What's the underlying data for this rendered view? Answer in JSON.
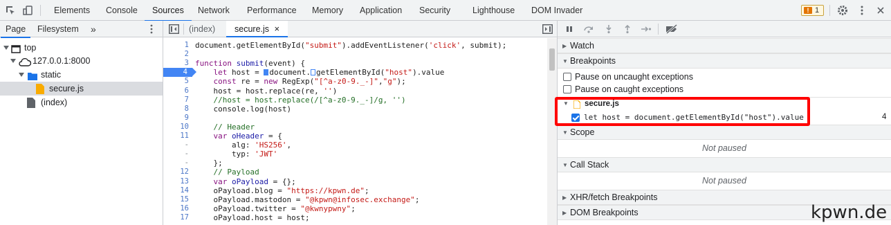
{
  "top_tabs": [
    "Elements",
    "Console",
    "Sources",
    "Network",
    "Performance",
    "Memory",
    "Application",
    "Security",
    "Lighthouse",
    "DOM Invader"
  ],
  "issues_count": "1",
  "navigator": {
    "tabs": [
      "Page",
      "Filesystem"
    ],
    "more": "»",
    "tree": [
      {
        "label": "top",
        "icon": "frame-icon"
      },
      {
        "label": "127.0.0.1:8000",
        "icon": "cloud-icon"
      },
      {
        "label": "static",
        "icon": "folder-icon"
      },
      {
        "label": "secure.js",
        "icon": "js-file-icon",
        "selected": true
      },
      {
        "label": "(index)",
        "icon": "document-icon"
      }
    ]
  },
  "editor": {
    "tabs": [
      "(index)",
      "secure.js"
    ],
    "close": "×",
    "breakpoint_line": "4",
    "gutter": [
      "1",
      "2",
      "3",
      "4",
      "5",
      "6",
      "7",
      "8",
      "9",
      "10",
      "11",
      "-",
      "-",
      "-",
      "12",
      "13",
      "14",
      "15",
      "16",
      "17"
    ],
    "lines": [
      "document.getElementById(\"submit\").addEventListener('click', submit);",
      "",
      "function submit(event) {",
      "    let host = document.getElementById(\"host\").value",
      "    const re = new RegExp(\"[^a-z0-9._-]\",\"g\");",
      "    host = host.replace(re, '')",
      "    //host = host.replace(/[^a-z0-9._-]/g, '')",
      "    console.log(host)",
      "",
      "    // Header",
      "    var oHeader = {",
      "        alg: 'HS256',",
      "        typ: 'JWT'",
      "    };",
      "    // Payload",
      "    var oPayload = {};",
      "    oPayload.blog = \"https://kpwn.de\";",
      "    oPayload.mastodon = \"@kpwn@infosec.exchange\";",
      "    oPayload.twitter = \"@kwnypwny\";",
      "    oPayload.host = host;"
    ]
  },
  "sidebar": {
    "watch": "Watch",
    "breakpoints": "Breakpoints",
    "pause_uncaught": "Pause on uncaught exceptions",
    "pause_caught": "Pause on caught exceptions",
    "bp_file": "secure.js",
    "bp_code": "let host = document.getElementById(\"host\").value",
    "bp_line": "4",
    "scope": "Scope",
    "not_paused_1": "Not paused",
    "call_stack": "Call Stack",
    "not_paused_2": "Not paused",
    "xhr": "XHR/fetch Breakpoints",
    "dom": "DOM Breakpoints"
  },
  "watermark": "kpwn.de",
  "colors": {
    "accent": "#1a73e8",
    "highlight": "#ff0000"
  }
}
